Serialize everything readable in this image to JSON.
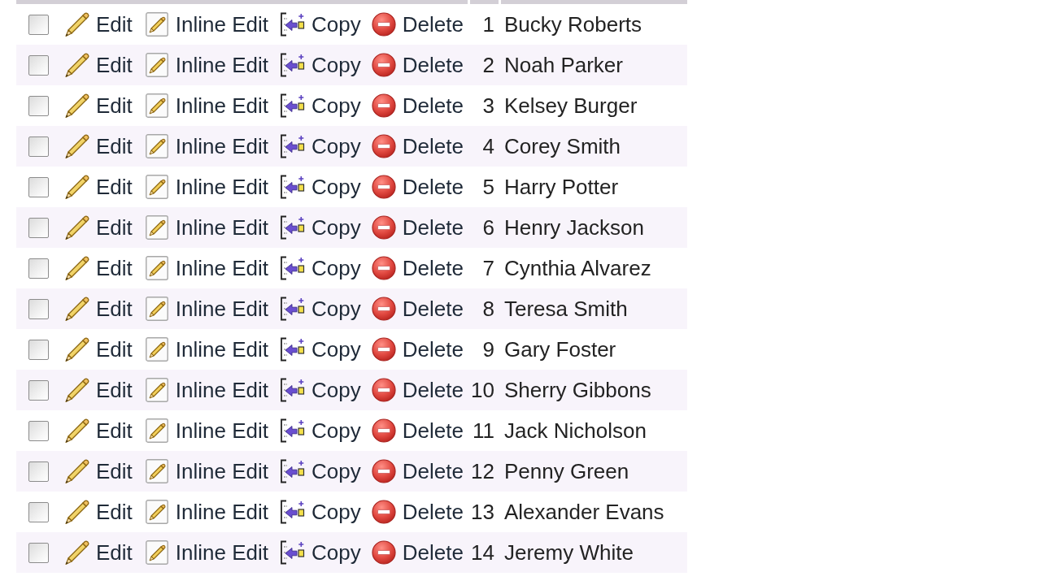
{
  "table": {
    "rows": [
      {
        "checked": false,
        "actions": [
          {
            "kind": "edit",
            "label": "Edit"
          },
          {
            "kind": "inline_edit",
            "label": "Inline Edit"
          },
          {
            "kind": "copy",
            "label": "Copy"
          },
          {
            "kind": "delete",
            "label": "Delete"
          }
        ],
        "id": "1",
        "name": "Bucky Roberts"
      },
      {
        "checked": false,
        "actions": [
          {
            "kind": "edit",
            "label": "Edit"
          },
          {
            "kind": "inline_edit",
            "label": "Inline Edit"
          },
          {
            "kind": "copy",
            "label": "Copy"
          },
          {
            "kind": "delete",
            "label": "Delete"
          }
        ],
        "id": "2",
        "name": "Noah Parker"
      },
      {
        "checked": false,
        "actions": [
          {
            "kind": "edit",
            "label": "Edit"
          },
          {
            "kind": "inline_edit",
            "label": "Inline Edit"
          },
          {
            "kind": "copy",
            "label": "Copy"
          },
          {
            "kind": "delete",
            "label": "Delete"
          }
        ],
        "id": "3",
        "name": "Kelsey Burger"
      },
      {
        "checked": false,
        "actions": [
          {
            "kind": "edit",
            "label": "Edit"
          },
          {
            "kind": "inline_edit",
            "label": "Inline Edit"
          },
          {
            "kind": "copy",
            "label": "Copy"
          },
          {
            "kind": "delete",
            "label": "Delete"
          }
        ],
        "id": "4",
        "name": "Corey Smith"
      },
      {
        "checked": false,
        "actions": [
          {
            "kind": "edit",
            "label": "Edit"
          },
          {
            "kind": "inline_edit",
            "label": "Inline Edit"
          },
          {
            "kind": "copy",
            "label": "Copy"
          },
          {
            "kind": "delete",
            "label": "Delete"
          }
        ],
        "id": "5",
        "name": "Harry Potter"
      },
      {
        "checked": false,
        "actions": [
          {
            "kind": "edit",
            "label": "Edit"
          },
          {
            "kind": "inline_edit",
            "label": "Inline Edit"
          },
          {
            "kind": "copy",
            "label": "Copy"
          },
          {
            "kind": "delete",
            "label": "Delete"
          }
        ],
        "id": "6",
        "name": "Henry Jackson"
      },
      {
        "checked": false,
        "actions": [
          {
            "kind": "edit",
            "label": "Edit"
          },
          {
            "kind": "inline_edit",
            "label": "Inline Edit"
          },
          {
            "kind": "copy",
            "label": "Copy"
          },
          {
            "kind": "delete",
            "label": "Delete"
          }
        ],
        "id": "7",
        "name": "Cynthia Alvarez"
      },
      {
        "checked": false,
        "actions": [
          {
            "kind": "edit",
            "label": "Edit"
          },
          {
            "kind": "inline_edit",
            "label": "Inline Edit"
          },
          {
            "kind": "copy",
            "label": "Copy"
          },
          {
            "kind": "delete",
            "label": "Delete"
          }
        ],
        "id": "8",
        "name": "Teresa Smith"
      },
      {
        "checked": false,
        "actions": [
          {
            "kind": "edit",
            "label": "Edit"
          },
          {
            "kind": "inline_edit",
            "label": "Inline Edit"
          },
          {
            "kind": "copy",
            "label": "Copy"
          },
          {
            "kind": "delete",
            "label": "Delete"
          }
        ],
        "id": "9",
        "name": "Gary Foster"
      },
      {
        "checked": false,
        "actions": [
          {
            "kind": "edit",
            "label": "Edit"
          },
          {
            "kind": "inline_edit",
            "label": "Inline Edit"
          },
          {
            "kind": "copy",
            "label": "Copy"
          },
          {
            "kind": "delete",
            "label": "Delete"
          }
        ],
        "id": "10",
        "name": "Sherry Gibbons"
      },
      {
        "checked": false,
        "actions": [
          {
            "kind": "edit",
            "label": "Edit"
          },
          {
            "kind": "inline_edit",
            "label": "Inline Edit"
          },
          {
            "kind": "copy",
            "label": "Copy"
          },
          {
            "kind": "delete",
            "label": "Delete"
          }
        ],
        "id": "11",
        "name": "Jack Nicholson"
      },
      {
        "checked": false,
        "actions": [
          {
            "kind": "edit",
            "label": "Edit"
          },
          {
            "kind": "inline_edit",
            "label": "Inline Edit"
          },
          {
            "kind": "copy",
            "label": "Copy"
          },
          {
            "kind": "delete",
            "label": "Delete"
          }
        ],
        "id": "12",
        "name": "Penny Green"
      },
      {
        "checked": false,
        "actions": [
          {
            "kind": "edit",
            "label": "Edit"
          },
          {
            "kind": "inline_edit",
            "label": "Inline Edit"
          },
          {
            "kind": "copy",
            "label": "Copy"
          },
          {
            "kind": "delete",
            "label": "Delete"
          }
        ],
        "id": "13",
        "name": "Alexander Evans"
      },
      {
        "checked": false,
        "actions": [
          {
            "kind": "edit",
            "label": "Edit"
          },
          {
            "kind": "inline_edit",
            "label": "Inline Edit"
          },
          {
            "kind": "copy",
            "label": "Copy"
          },
          {
            "kind": "delete",
            "label": "Delete"
          }
        ],
        "id": "14",
        "name": "Jeremy White"
      }
    ]
  }
}
